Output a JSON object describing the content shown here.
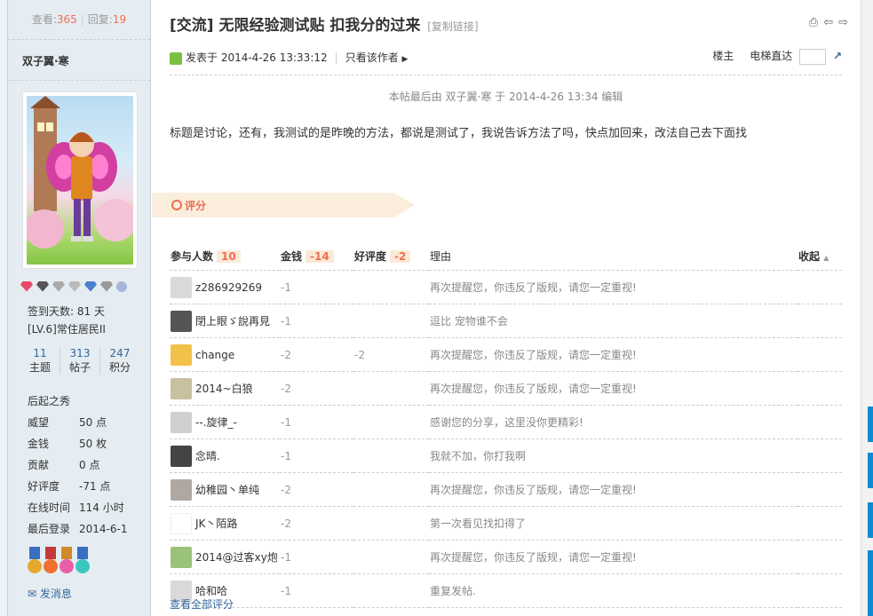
{
  "stats": {
    "views_label": "查看:",
    "views": "365",
    "replies_label": "回复:",
    "replies": "19"
  },
  "author": {
    "name": "双子翼·寒"
  },
  "info": {
    "signin": "签到天数: 81 天",
    "level": "[LV.6]常住居民II"
  },
  "counts": [
    {
      "num": "11",
      "label": "主题"
    },
    {
      "num": "313",
      "label": "帖子"
    },
    {
      "num": "247",
      "label": "积分"
    }
  ],
  "profile": {
    "title": "后起之秀",
    "rows": [
      {
        "k": "威望",
        "v": "50 点"
      },
      {
        "k": "金钱",
        "v": "50 枚"
      },
      {
        "k": "贡献",
        "v": "0 点"
      },
      {
        "k": "好评度",
        "v": "-71 点"
      },
      {
        "k": "在线时间",
        "v": "114 小时"
      },
      {
        "k": "最后登录",
        "v": "2014-6-1"
      }
    ],
    "send_msg": "发消息"
  },
  "post": {
    "title": "[交流] 无限经验测试贴 扣我分的过来",
    "copy_link": "[复制链接]",
    "posted": "发表于 2014-4-26 13:33:12",
    "only_author": "只看该作者",
    "floor": "楼主",
    "elevator": "电梯直达",
    "edit_note": "本帖最后由 双子翼·寒 于 2014-4-26 13:34 编辑",
    "body": "标题是讨论，还有，我测试的是昨晚的方法，都说是测试了，我说告诉方法了吗，快点加回来，改法自己去下面找"
  },
  "rating": {
    "tab_label": "评分",
    "h_people": "参与人数",
    "h_people_num": "10",
    "h_money": "金钱",
    "h_money_num": "-14",
    "h_rep": "好评度",
    "h_rep_num": "-2",
    "h_reason": "理由",
    "collapse": "收起",
    "rows": [
      {
        "user": "z286929269",
        "money": "-1",
        "rep": "",
        "reason": "再次提醒您，你违反了版规，请您一定重视!"
      },
      {
        "user": "閉上眼ゞ說再見",
        "money": "-1",
        "rep": "",
        "reason": "逗比 宠物谁不会"
      },
      {
        "user": "change",
        "money": "-2",
        "rep": "-2",
        "reason": "再次提醒您，你违反了版规，请您一定重视!"
      },
      {
        "user": "2014~白狼",
        "money": "-2",
        "rep": "",
        "reason": "再次提醒您，你违反了版规，请您一定重视!"
      },
      {
        "user": "--.旋律_-",
        "money": "-1",
        "rep": "",
        "reason": "感谢您的分享，这里没你更精彩!"
      },
      {
        "user": "念晴.",
        "money": "-1",
        "rep": "",
        "reason": "我就不加，你打我啊"
      },
      {
        "user": "幼稚园丶单纯",
        "money": "-2",
        "rep": "",
        "reason": "再次提醒您，你违反了版规，请您一定重视!"
      },
      {
        "user": "JK丶陌路",
        "money": "-2",
        "rep": "",
        "reason": "第一次看见找扣得了"
      },
      {
        "user": "2014@过客xy炮坻",
        "money": "-1",
        "rep": "",
        "reason": "再次提醒您，你违反了版规，请您一定重视!"
      },
      {
        "user": "哈和哈",
        "money": "-1",
        "rep": "",
        "reason": "重复发帖."
      }
    ],
    "view_all": "查看全部评分"
  },
  "colors": {
    "accent": "#f26c4f",
    "link": "#336699",
    "sidebar": "#e5edf2"
  }
}
